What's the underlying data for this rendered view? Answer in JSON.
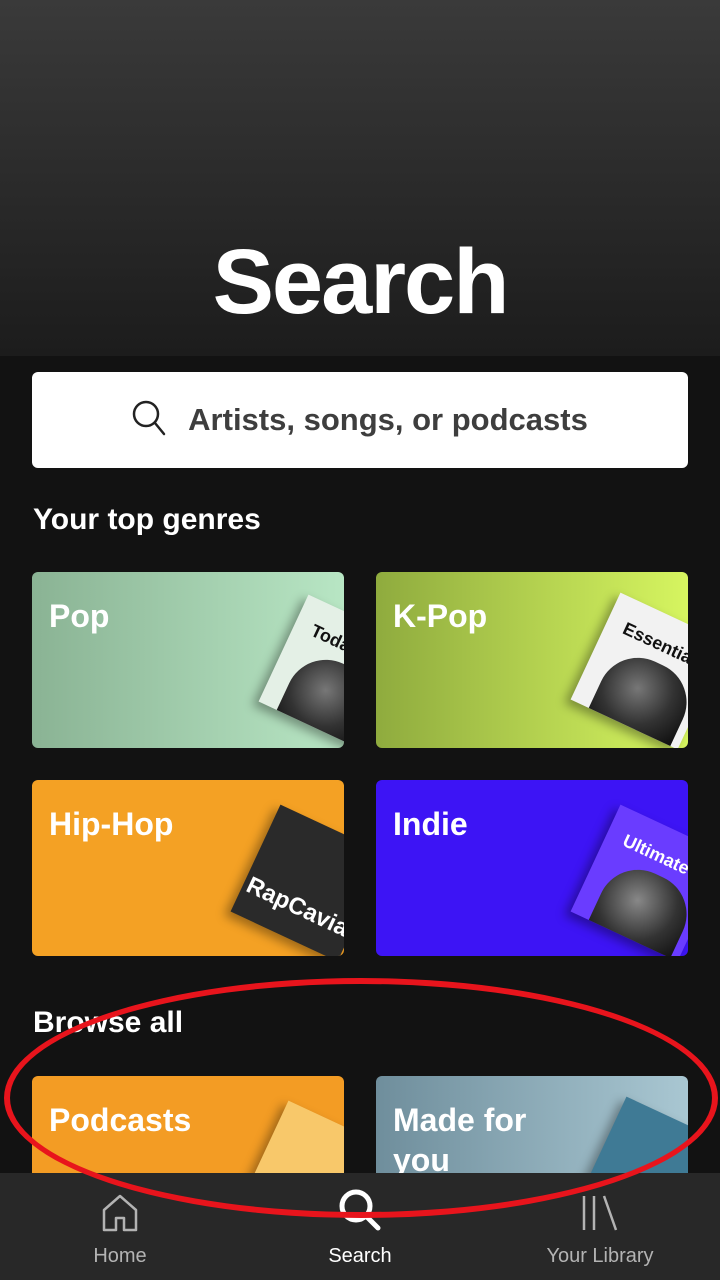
{
  "header": {
    "title": "Search"
  },
  "search": {
    "placeholder": "Artists, songs, or podcasts"
  },
  "top_genres": {
    "title": "Your top genres",
    "tiles": [
      {
        "label": "Pop",
        "color": "#a7d6ad",
        "cover_text": "Today's Top Hits"
      },
      {
        "label": "K-Pop",
        "color": "#b6dc55",
        "cover_text": "Essential K-Pop"
      },
      {
        "label": "Hip-Hop",
        "color": "#f4a124",
        "cover_text": "RapCaviar"
      },
      {
        "label": "Indie",
        "color": "#3d14f5",
        "cover_text": "Ultimate Indie"
      }
    ]
  },
  "browse_all": {
    "title": "Browse all",
    "tiles": [
      {
        "label": "Podcasts",
        "color": "#f39c24"
      },
      {
        "label": "Made for you",
        "color": "#7d9cab"
      }
    ]
  },
  "tabbar": {
    "tabs": [
      {
        "label": "Home",
        "icon": "home-icon",
        "active": false
      },
      {
        "label": "Search",
        "icon": "search-icon",
        "active": true
      },
      {
        "label": "Your Library",
        "icon": "library-icon",
        "active": false
      }
    ]
  },
  "colors": {
    "background": "#121212",
    "accent_annotation": "#e8141c"
  }
}
